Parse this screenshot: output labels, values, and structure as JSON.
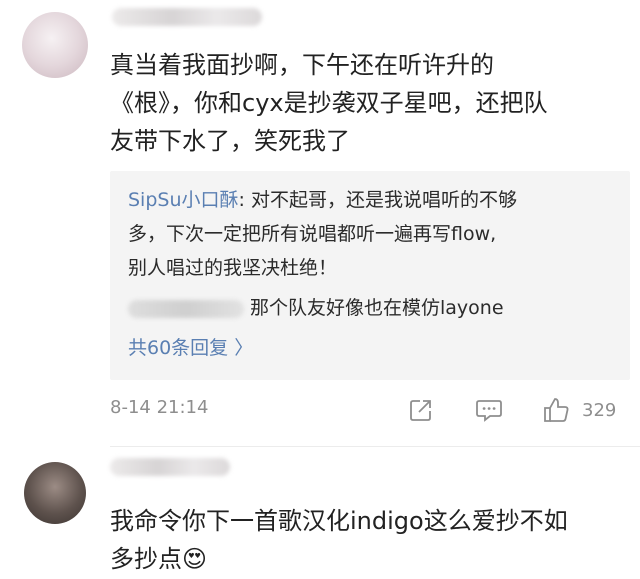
{
  "comment1": {
    "lines": [
      "真当着我面抄啊，下午还在听许升的",
      "《根》，你和cyx是抄袭双子星吧，还把队",
      "友带下水了，笑死我了"
    ],
    "replies": {
      "reply1_user": "SipSu小口酥",
      "reply1_line1_rest": ": 对不起哥，还是我说唱听的不够",
      "reply1_line2": "多，下次一定把所有说唱都听一遍再写flow,",
      "reply1_line3": "别人唱过的我坚决杜绝！",
      "reply2_text": "那个队友好像也在模仿layone",
      "count_label": "共60条回复 〉"
    },
    "timestamp": "8-14 21:14",
    "like_count": "329"
  },
  "comment2": {
    "lines": [
      "我命令你下一首歌汉化indigo这么爱抄不如",
      "多抄点😍"
    ]
  }
}
